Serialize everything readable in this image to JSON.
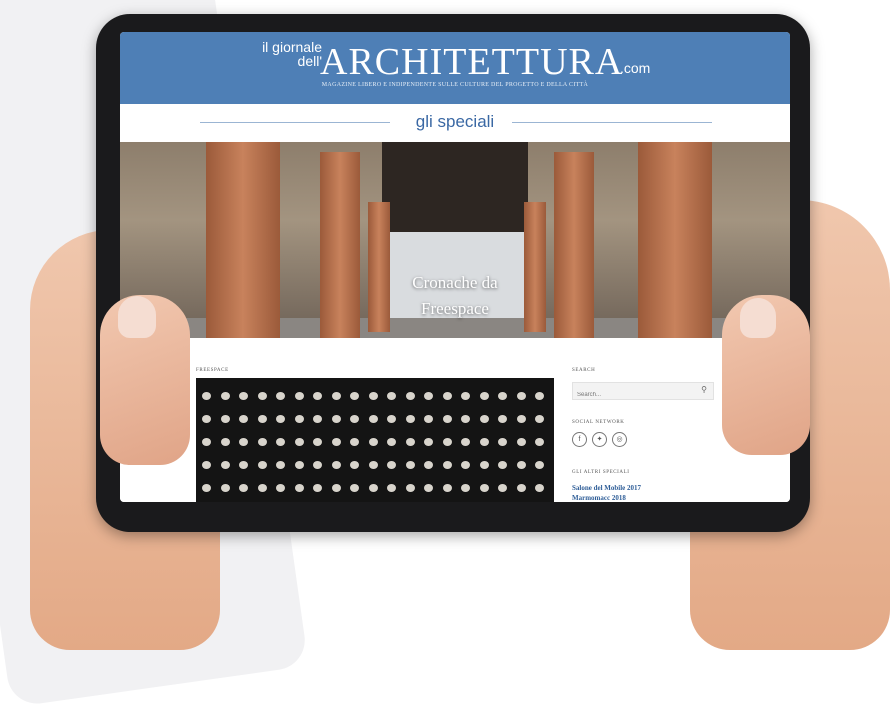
{
  "header": {
    "brand_prefix_line1": "il giornale",
    "brand_prefix_line2": "dell'",
    "brand_main": "ARCHITETTURA",
    "brand_suffix": ".com",
    "tagline": "MAGAZINE LIBERO E INDIPENDENTE SULLE CULTURE DEL PROGETTO E DELLA CITTÀ",
    "color": "#4e7fb6"
  },
  "section": {
    "title": "gli speciali"
  },
  "hero": {
    "caption_line1": "Cronache da",
    "caption_line2": "Freespace"
  },
  "main": {
    "gallery_label": "FREESPACE"
  },
  "sidebar": {
    "search_heading": "SEARCH",
    "search_placeholder": "Search...",
    "social_heading": "SOCIAL NETWORK",
    "social_icons": [
      "facebook-icon",
      "twitter-icon",
      "instagram-icon"
    ],
    "specials_heading": "GLI ALTRI SPECIALI",
    "specials": [
      "Salone del Mobile 2017",
      "Marmomacc 2018"
    ]
  }
}
